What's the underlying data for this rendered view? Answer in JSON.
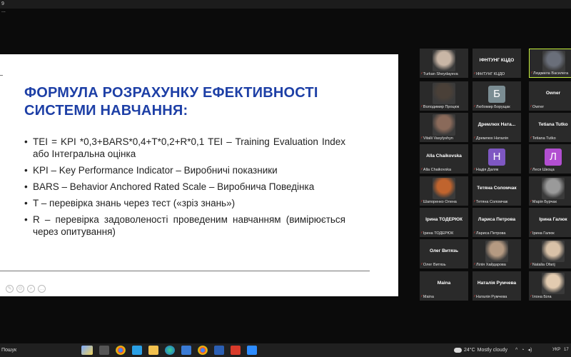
{
  "topbar": {
    "label": "9",
    "sub_label": "..."
  },
  "slide": {
    "title": "ФОРМУЛА РОЗРАХУНКУ ЕФЕКТИВНОСТІ СИСТЕМИ НАВЧАННЯ:",
    "bullets": [
      "TEI = KPI *0,3+BARS*0,4+T*0,2+R*0,1 TEI – Training Evaluation Index або Інтегральна оцінка",
      "KPI – Key Performance Indicator – Виробничі показники",
      " BARS – Behavior Anchored Rated Scale – Виробнича Поведінка",
      " T – перевірка знань через тест («зріз знань»)",
      "R – перевірка задоволеності проведеним навчанням (вимірюється через опитування)"
    ]
  },
  "participants": [
    {
      "name": "Turkan Sheydayeva",
      "display": "photo",
      "color": "#c9b6a6"
    },
    {
      "name": "ІФНТУНГ КЦДО",
      "display": "text",
      "center": "ІФНТУНГ КЦДО"
    },
    {
      "name": "Людмила Василега",
      "display": "photo",
      "color": "#6a6f7a",
      "active": true
    },
    {
      "name": "Володимир Процюк",
      "display": "photo",
      "color": "#4a4038"
    },
    {
      "name": "Любомир Борущак",
      "display": "avatar",
      "letter": "Б",
      "color": "#7b8d93"
    },
    {
      "name": "Owner",
      "display": "text",
      "center": "Owner"
    },
    {
      "name": "Vitalii Vasylyshyn",
      "display": "photo",
      "color": "#8a6a5a"
    },
    {
      "name": "Дремлюх Наталія",
      "display": "text",
      "center": "Дремлюх Ната..."
    },
    {
      "name": "Tetiana Tutko",
      "display": "text",
      "center": "Tetiana Tutko"
    },
    {
      "name": "Alla Chaikovska",
      "display": "text",
      "center": "Alla Chaikovska"
    },
    {
      "name": "Надія Даляк",
      "display": "avatar",
      "letter": "Н",
      "color": "#7e57c2"
    },
    {
      "name": "Леся Шкоца",
      "display": "avatar",
      "letter": "Л",
      "color": "#b24fd1"
    },
    {
      "name": "Шапоренко Олена",
      "display": "photo",
      "color": "#c0642e"
    },
    {
      "name": "Тетяна Соломчак",
      "display": "text",
      "center": "Тетяна Соломчак"
    },
    {
      "name": "Марія Бурчак",
      "display": "photo",
      "color": "#9a9a9a"
    },
    {
      "name": "Ірина ТОДЕРЮК",
      "display": "text",
      "center": "Ірина ТОДЕРЮК"
    },
    {
      "name": "Лариса Петрова",
      "display": "text",
      "center": "Лариса Петрова"
    },
    {
      "name": "Ірина Галюк",
      "display": "text",
      "center": "Ірина Галюк"
    },
    {
      "name": "Олег Витязь",
      "display": "text",
      "center": "Олег Витязь"
    },
    {
      "name": "Лілія Хайдарова",
      "display": "photo",
      "color": "#b59a82"
    },
    {
      "name": "Natalia Ofarij",
      "display": "photo",
      "color": "#d9c2a8"
    },
    {
      "name": "Maina",
      "display": "text",
      "center": "Maina"
    },
    {
      "name": "Наталія Румчева",
      "display": "text",
      "center": "Наталія Румчева"
    },
    {
      "name": "Ілона Біла",
      "display": "photo",
      "color": "#e2cbb0"
    }
  ],
  "taskbar": {
    "search_label": "Пошук",
    "weather_temp": "24°C",
    "weather_text": "Mostly cloudy",
    "tray_up": "^",
    "tray_wifi": "◔",
    "tray_volume": "◂)",
    "lang": "УКР",
    "time": "17"
  }
}
